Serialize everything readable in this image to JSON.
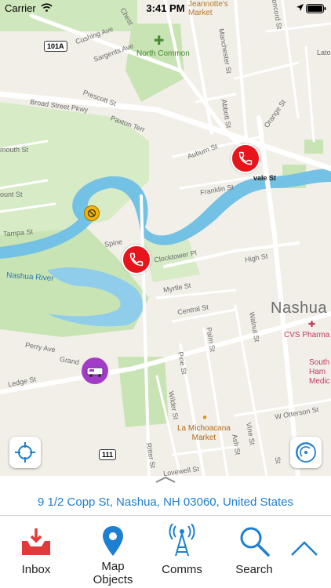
{
  "status_bar": {
    "carrier": "Carrier",
    "time": "3:41 PM"
  },
  "map": {
    "city_label": "Nashua",
    "river_label": "Nashua River",
    "pois": {
      "north_common": "North Common",
      "jeannottes_market": "Jeannotte's\nMarket",
      "cvs": "CVS Pharma",
      "southern_nh_medical": "South\nHam\nMedic",
      "la_michoacana": "La Michoacana\nMarket"
    },
    "shields": {
      "route_101a": "101A",
      "route_111": "111"
    },
    "streets": [
      "Cushing Ave",
      "Sargents Ave",
      "Broad Street Pkwy",
      "Prescott St",
      "Paxton Terr",
      "Auburn St",
      "Franklin St",
      "Abbott St",
      "Manchester St",
      "Orange St",
      "Concord St",
      "Spine",
      "Clocktower Pl",
      "High St",
      "Myrtle St",
      "Central St",
      "Walnut St",
      "Perry Ave",
      "Grand",
      "Ledge St",
      "Pine St",
      "Palm St",
      "Wilder St",
      "W Otterson St",
      "Vine St",
      "Ash St",
      "Ritter St",
      "Lovewell St",
      "Tampa St",
      "mouth St",
      "ount St",
      "vale St",
      "St",
      "Chest",
      "Lato"
    ],
    "colors": {
      "land": "#f2efe9",
      "park": "#c9e4b4",
      "water": "#74c1e6",
      "call_pin": "#e8141c",
      "vehicle_pin": "#a23cc8",
      "hazard_pin": "#f4b400",
      "accent": "#1d7fd1"
    }
  },
  "address": "9 1/2 Copp St, Nashua, NH  03060, United States",
  "tabs": [
    {
      "label": "Inbox",
      "icon": "inbox-icon"
    },
    {
      "label": "Map\nObjects",
      "icon": "map-pin-icon"
    },
    {
      "label": "Comms",
      "icon": "radio-tower-icon"
    },
    {
      "label": "Search",
      "icon": "search-icon"
    },
    {
      "label": "",
      "icon": "chevron-up-icon"
    }
  ]
}
